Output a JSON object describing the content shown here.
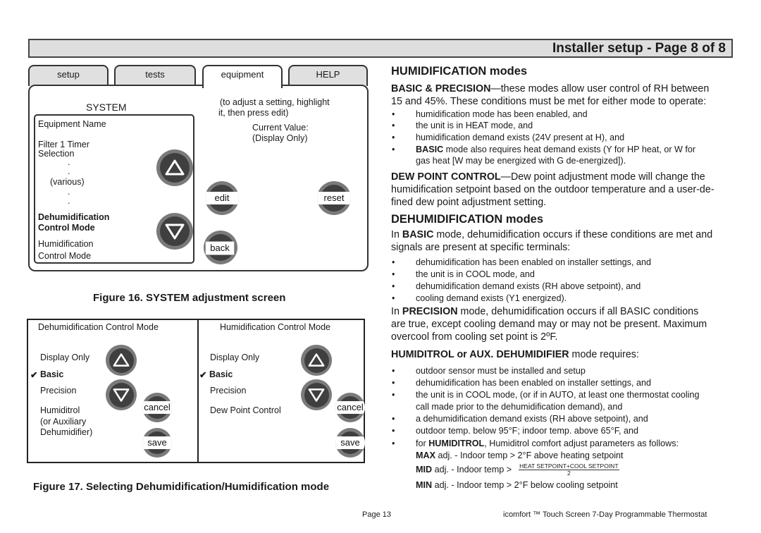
{
  "header": {
    "title": "Installer setup - Page 8 of 8"
  },
  "figure16": {
    "tabs": [
      {
        "label": "setup",
        "active": false
      },
      {
        "label": "tests",
        "active": false
      },
      {
        "label": "equipment",
        "active": true
      },
      {
        "label": "HELP",
        "active": false
      }
    ],
    "panel_title": "SYSTEM",
    "list_items": [
      {
        "text": "Equipment Name",
        "bold": false
      },
      {
        "text": "Filter 1 Timer",
        "bold": false
      },
      {
        "text": "Selection",
        "bold": false
      },
      {
        "text": ".",
        "bold": false
      },
      {
        "text": ".",
        "bold": false
      },
      {
        "text": "(various)",
        "bold": false
      },
      {
        "text": ".",
        "bold": false
      },
      {
        "text": ".",
        "bold": false
      },
      {
        "text": "Dehumidification",
        "bold": true
      },
      {
        "text": "Control Mode",
        "bold": true
      },
      {
        "text": "Humidification",
        "bold": false
      },
      {
        "text": "Control Mode",
        "bold": false
      }
    ],
    "hint_line1": "(to adjust a setting, highlight",
    "hint_line2": "it, then press edit)",
    "current_value_label": "Current Value:",
    "current_value": "(Display Only)",
    "buttons": {
      "edit": "edit",
      "reset": "reset",
      "back": "back"
    },
    "icons": {
      "up": "up-arrow-icon",
      "down": "down-arrow-icon"
    },
    "caption": "Figure 16. SYSTEM adjustment screen"
  },
  "figure17": {
    "left": {
      "title": "Dehumidification Control Mode",
      "options": [
        {
          "text": "Display Only",
          "selected": false
        },
        {
          "text": "Basic",
          "selected": true
        },
        {
          "text": "Precision",
          "selected": false
        },
        {
          "text": "Humiditrol",
          "selected": false
        },
        {
          "text": "(or Auxiliary",
          "selected": false
        },
        {
          "text": "Dehumidifier)",
          "selected": false
        }
      ]
    },
    "right": {
      "title": "Humidification Control Mode",
      "options": [
        {
          "text": "Display Only",
          "selected": false
        },
        {
          "text": "Basic",
          "selected": true
        },
        {
          "text": "Precision",
          "selected": false
        },
        {
          "text": "Dew Point Control",
          "selected": false
        }
      ]
    },
    "check_mark": "✔",
    "buttons": {
      "cancel": "cancel",
      "save": "save"
    },
    "caption": "Figure 17. Selecting Dehumidification/Humidification mode"
  },
  "content": {
    "humidification_heading": "HUMIDIFICATION modes",
    "basic_precision_lead": "BASIC & PRECISION",
    "basic_precision_text": "—these modes allow user control of RH between",
    "basic_precision_line2": "15 and 45%. These conditions must be met for either mode to operate:",
    "hum_bullets": [
      "humidification mode has been enabled, and",
      "the unit is in HEAT mode, and",
      "humidification demand exists (24V present at H), and"
    ],
    "hum_bullet4_lead": "BASIC",
    "hum_bullet4_text": " mode also requires heat demand exists (Y for HP heat, or W for",
    "hum_bullet4_line2": "gas heat [W may be energized with G de-energized]).",
    "dew_lead": "DEW  POINT CONTROL",
    "dew_text": "—Dew point adjustment mode will change the",
    "dew_line2": "humidification setpoint based on the outdoor temperature and a user-de-",
    "dew_line3": "fined dew point adjustment setting.",
    "dehumidification_heading": "DEHUMIDIFICATION modes",
    "basic_intro_pre": "In ",
    "basic_intro_bold": "BASIC",
    "basic_intro_post": " mode, dehumidification occurs if these conditions are met and",
    "basic_intro_line2": "signals are present at specific terminals:",
    "dehum_bullets": [
      "dehumidification has been enabled on installer settings, and",
      "the unit is in COOL mode, and",
      "dehumidification demand exists (RH above setpoint), and",
      "cooling demand exists (Y1 energized)."
    ],
    "precision_pre": "In ",
    "precision_bold": "PRECISION",
    "precision_post": " mode, dehumidification occurs if all BASIC conditions",
    "precision_line2": "are true, except cooling demand may or may not be present. Maximum",
    "precision_line3": "overcool from cooling set point is 2ºF.",
    "humiditrol_bold": "HUMIDITROL or AUX. DEHUMIDIFIER",
    "humiditrol_post": " mode requires:",
    "humiditrol_bullets": [
      "outdoor sensor must be installed and setup",
      "dehumidification has been enabled on installer settings, and",
      "the unit is in COOL mode, (or if in AUTO, at least one thermostat cooling",
      "a dehumidification demand exists (RH above setpoint), and",
      "outdoor temp. below 95°F; indoor temp. above 65°F, and"
    ],
    "humiditrol_bullet3_line2": "call made prior to the dehumidification demand), and",
    "last_bullet_pre": "for ",
    "last_bullet_bold": "HUMIDITROL",
    "last_bullet_post": ", Humiditrol comfort adjust parameters as follows:",
    "max_bold": "MAX",
    "max_text": " adj. - Indoor temp > 2°F above heating setpoint",
    "mid_bold": "MID",
    "mid_text": " adj. - Indoor temp >",
    "mid_numerator": "HEAT SETPOINT+COOL SETPOINT",
    "mid_denominator": "2",
    "min_bold": "MIN",
    "min_text": " adj. - Indoor temp > 2°F below cooling setpoint",
    "bullet_glyph": "•"
  },
  "footer": {
    "page": "Page 13",
    "product": "icomfort ™ Touch Screen 7-Day Programmable Thermostat"
  }
}
